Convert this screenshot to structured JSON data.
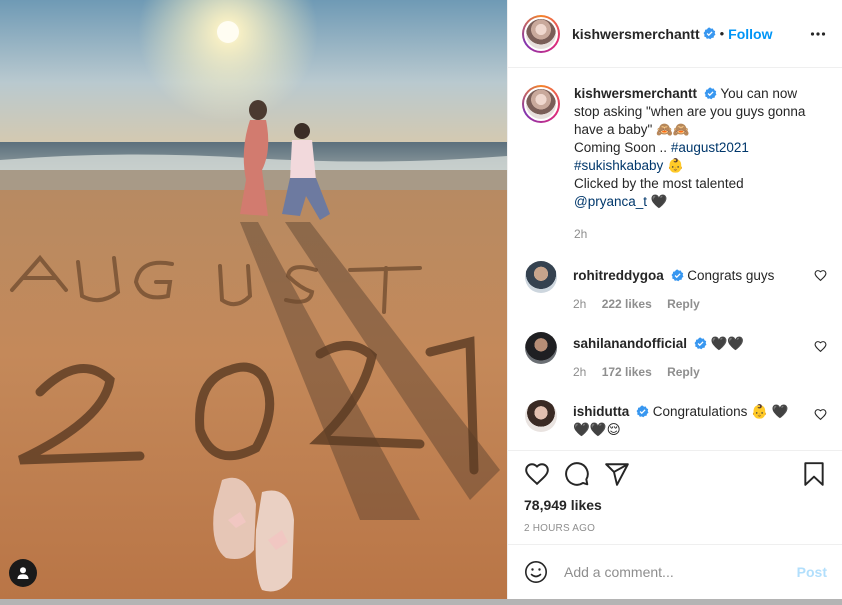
{
  "post": {
    "author": "kishwersmerchantt",
    "follow_label": "Follow",
    "separator": "•",
    "caption": {
      "author": "kishwersmerchantt",
      "line1": "You can now stop asking \"when are you guys gonna have a baby\" 🙈🙈",
      "line2_prefix": "Coming Soon .. ",
      "hashtag1": "#august2021",
      "hashtag2": "#sukishkababy",
      "hashtag2_suffix": " 👶",
      "line4": "Clicked by the most talented",
      "mention": "@pryanca_t",
      "mention_suffix": " 🖤",
      "time": "2h"
    },
    "comments": [
      {
        "user": "rohitreddygoa",
        "text": "Congrats guys",
        "time": "2h",
        "likes": "222 likes",
        "reply": "Reply"
      },
      {
        "user": "sahilanandofficial",
        "text": "🖤🖤",
        "time": "2h",
        "likes": "172 likes",
        "reply": "Reply"
      },
      {
        "user": "ishidutta",
        "text": "Congratulations 👶 🖤 🖤🖤😌",
        "time": "",
        "likes": "",
        "reply": ""
      }
    ],
    "likes_count": "78,949 likes",
    "time_ago": "2 HOURS AGO",
    "comment_placeholder": "Add a comment...",
    "post_button": "Post"
  },
  "colors": {
    "accent": "#0095f6",
    "verified": "#3897f0",
    "hashtag": "#00376b",
    "muted": "#8e8e8e",
    "post_disabled": "#b2dffc"
  },
  "icons": [
    "user-tag-icon",
    "verified-icon",
    "more-icon",
    "heart-icon",
    "comment-icon",
    "share-icon",
    "save-icon",
    "emoji-icon"
  ]
}
